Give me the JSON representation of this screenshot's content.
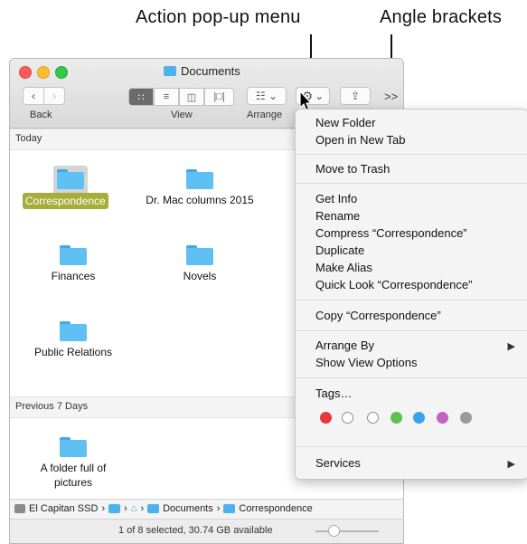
{
  "callouts": {
    "action_menu": "Action pop-up menu",
    "angle_brackets": "Angle brackets"
  },
  "window": {
    "title": "Documents",
    "toolbar": {
      "back_label": "Back",
      "view_label": "View",
      "arrange_label": "Arrange",
      "brackets": ">>"
    },
    "sections": [
      {
        "label": "Today"
      },
      {
        "label": "Previous 7 Days"
      }
    ],
    "files": {
      "correspondence": "Correspondence",
      "drmac": "Dr. Mac columns 2015",
      "finances": "Finances",
      "novels": "Novels",
      "public_relations": "Public Relations",
      "folder_full": "A folder full of pictures"
    },
    "path": [
      "El Capitan SSD",
      "",
      "",
      "Documents",
      "Correspondence"
    ],
    "status": "1 of 8 selected, 30.74 GB available"
  },
  "menu": {
    "items": [
      "New Folder",
      "Open in New Tab",
      "Move to Trash",
      "Get Info",
      "Rename",
      "Compress “Correspondence”",
      "Duplicate",
      "Make Alias",
      "Quick Look “Correspondence”",
      "Copy “Correspondence”",
      "Arrange By",
      "Show View Options",
      "Tags…",
      "Services"
    ],
    "tag_colors": [
      "#e8383b",
      "#ffffff",
      "#ffffff",
      "#5cc24e",
      "#3aa3ec",
      "#c463c4",
      "#9a9a9a"
    ]
  },
  "colors": {
    "selection": "#a6ad3a",
    "folder": "#5ec0f3"
  }
}
